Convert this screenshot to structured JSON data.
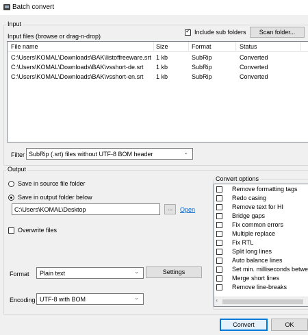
{
  "window": {
    "title": "Batch convert",
    "icon": "app-icon"
  },
  "input_group": {
    "title": "Input",
    "files_label": "Input files (browse or drag-n-drop)",
    "include_subfolders_label": "Include sub folders",
    "include_subfolders_checked": true,
    "scan_folder_label": "Scan folder...",
    "columns": [
      "File name",
      "Size",
      "Format",
      "Status"
    ],
    "rows": [
      {
        "file": "C:\\Users\\KOMAL\\Downloads\\BAK\\listoffreeware.srt",
        "size": "1 kb",
        "format": "SubRip",
        "status": "Converted"
      },
      {
        "file": "C:\\Users\\KOMAL\\Downloads\\BAK\\vsshort-de.srt",
        "size": "1 kb",
        "format": "SubRip",
        "status": "Converted"
      },
      {
        "file": "C:\\Users\\KOMAL\\Downloads\\BAK\\vsshort-en.srt",
        "size": "1 kb",
        "format": "SubRip",
        "status": "Converted"
      }
    ],
    "filter_label": "Filter",
    "filter_value": "SubRip (.srt) files without UTF-8 BOM header"
  },
  "output_group": {
    "title": "Output",
    "save_source_label": "Save in source file folder",
    "save_output_label": "Save in output folder below",
    "selected_option": "save_output",
    "output_folder": "C:\\Users\\KOMAL\\Desktop",
    "browse_label": "...",
    "open_label": "Open",
    "overwrite_label": "Overwrite files",
    "overwrite_checked": false,
    "format_label": "Format",
    "format_value": "Plain text",
    "settings_label": "Settings",
    "encoding_label": "Encoding",
    "encoding_value": "UTF-8 with BOM"
  },
  "convert_options": {
    "title": "Convert options",
    "items": [
      {
        "label": "Remove formatting tags",
        "checked": false
      },
      {
        "label": "Redo casing",
        "checked": false
      },
      {
        "label": "Remove text for HI",
        "checked": false
      },
      {
        "label": "Bridge gaps",
        "checked": false
      },
      {
        "label": "Fix common errors",
        "checked": false
      },
      {
        "label": "Multiple replace",
        "checked": false
      },
      {
        "label": "Fix RTL",
        "checked": false
      },
      {
        "label": "Split long lines",
        "checked": false
      },
      {
        "label": "Auto balance lines",
        "checked": false
      },
      {
        "label": "Set min. milliseconds between",
        "checked": false
      },
      {
        "label": "Merge short lines",
        "checked": false
      },
      {
        "label": "Remove line-breaks",
        "checked": false
      }
    ]
  },
  "footer": {
    "convert_label": "Convert",
    "ok_label": "OK"
  }
}
